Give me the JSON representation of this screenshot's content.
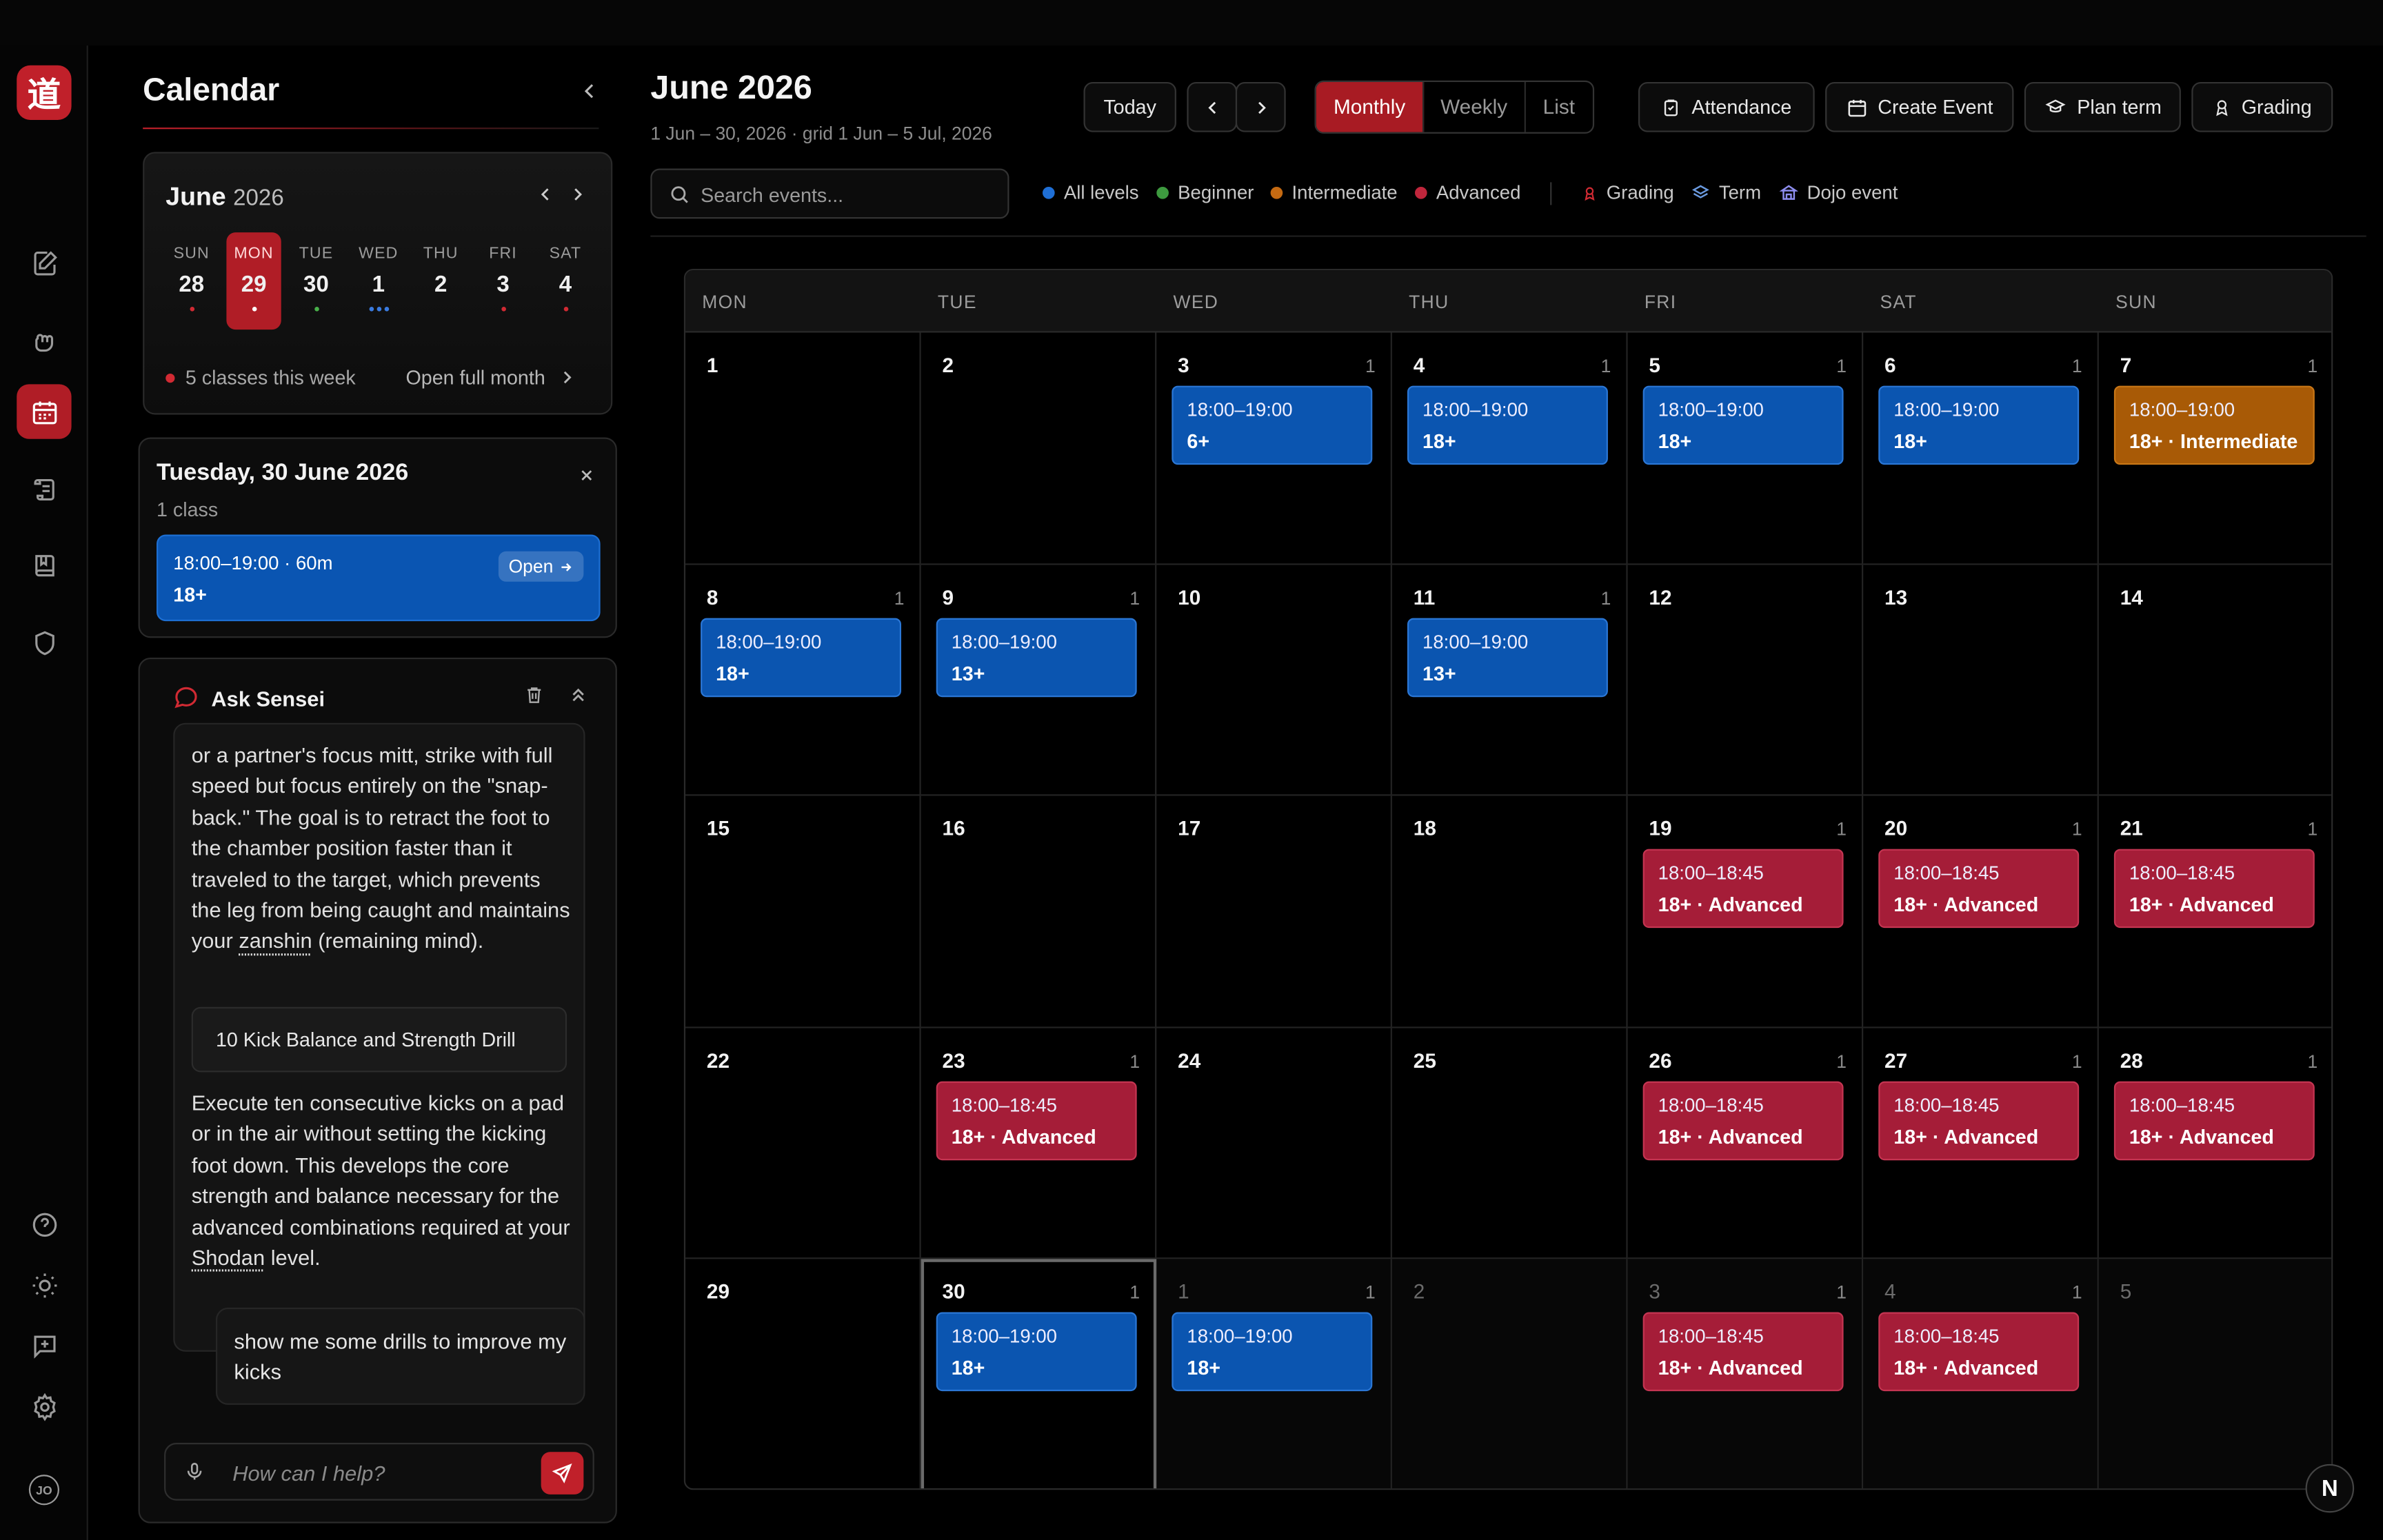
{
  "rail": {
    "logo": "道",
    "avatar": "JO",
    "icons": [
      "notes-icon",
      "fist-icon",
      "calendar-icon",
      "scroll-icon",
      "book-icon",
      "shield-icon",
      "help-icon",
      "theme-icon",
      "feedback-icon",
      "settings-icon"
    ]
  },
  "sidebar": {
    "title": "Calendar",
    "mini_calendar": {
      "month": "June",
      "year": "2026",
      "days": [
        {
          "dow": "SUN",
          "num": "28",
          "dots": [
            "#d12a33"
          ],
          "selected": false
        },
        {
          "dow": "MON",
          "num": "29",
          "dots": [
            "#ffffff"
          ],
          "selected": true
        },
        {
          "dow": "TUE",
          "num": "30",
          "dots": [
            "#48b04a"
          ],
          "selected": false
        },
        {
          "dow": "WED",
          "num": "1",
          "dots": [
            "#3a7be0",
            "#3a7be0",
            "#3a7be0"
          ],
          "selected": false
        },
        {
          "dow": "THU",
          "num": "2",
          "dots": [],
          "selected": false
        },
        {
          "dow": "FRI",
          "num": "3",
          "dots": [
            "#d12a33"
          ],
          "selected": false
        },
        {
          "dow": "SAT",
          "num": "4",
          "dots": [
            "#d12a33"
          ],
          "selected": false
        }
      ],
      "week_summary": "5 classes this week",
      "open_full_month": "Open full month"
    },
    "day_card": {
      "title": "Tuesday, 30 June 2026",
      "subtitle": "1 class",
      "event_time": "18:00–19:00 · 60m",
      "event_audience": "18+",
      "open_label": "Open"
    },
    "sensei": {
      "title": "Ask Sensei",
      "para1_pre": "or a partner's focus mitt, strike with full speed but focus entirely on the \"snap-back.\" The goal is to retract the foot to the chamber position faster than it traveled to the target, which prevents the leg from being caught and maintains your ",
      "para1_term": "zanshin",
      "para1_post": " (remaining mind).",
      "drill_title": "10 Kick Balance and Strength Drill",
      "para2_pre": "Execute ten consecutive kicks on a pad or in the air without setting the kicking foot down. This develops the core strength and balance necessary for the advanced combinations required at your ",
      "para2_term": "Shodan",
      "para2_post": " level.",
      "user_message": "show me some drills to improve my kicks",
      "input_placeholder": "How can I help?"
    }
  },
  "header": {
    "title": "June 2026",
    "subtitle": "1 Jun – 30, 2026 · grid 1 Jun – 5 Jul, 2026",
    "today": "Today",
    "views": [
      "Monthly",
      "Weekly",
      "List"
    ],
    "active_view": "Monthly",
    "actions": [
      "Attendance",
      "Create Event",
      "Plan term",
      "Grading"
    ],
    "search_placeholder": "Search events...",
    "legend_levels": [
      {
        "label": "All levels",
        "color": "#1f6fd6"
      },
      {
        "label": "Beginner",
        "color": "#3d9a3f"
      },
      {
        "label": "Intermediate",
        "color": "#c56a12"
      },
      {
        "label": "Advanced",
        "color": "#c0263c"
      }
    ],
    "legend_types": [
      "Grading",
      "Term",
      "Dojo event"
    ]
  },
  "calendar": {
    "dow": [
      "MON",
      "TUE",
      "WED",
      "THU",
      "FRI",
      "SAT",
      "SUN"
    ],
    "weeks": [
      [
        {
          "day": "1"
        },
        {
          "day": "2"
        },
        {
          "day": "3",
          "count": "1",
          "event": {
            "time": "18:00–19:00",
            "label": "6+",
            "color": "blue"
          }
        },
        {
          "day": "4",
          "count": "1",
          "event": {
            "time": "18:00–19:00",
            "label": "18+",
            "color": "blue"
          }
        },
        {
          "day": "5",
          "count": "1",
          "event": {
            "time": "18:00–19:00",
            "label": "18+",
            "color": "blue"
          }
        },
        {
          "day": "6",
          "count": "1",
          "event": {
            "time": "18:00–19:00",
            "label": "18+",
            "color": "blue"
          }
        },
        {
          "day": "7",
          "count": "1",
          "event": {
            "time": "18:00–19:00",
            "label": "18+ · Intermediate",
            "color": "orange"
          }
        }
      ],
      [
        {
          "day": "8",
          "count": "1",
          "event": {
            "time": "18:00–19:00",
            "label": "18+",
            "color": "blue"
          }
        },
        {
          "day": "9",
          "count": "1",
          "event": {
            "time": "18:00–19:00",
            "label": "13+",
            "color": "blue"
          }
        },
        {
          "day": "10"
        },
        {
          "day": "11",
          "count": "1",
          "event": {
            "time": "18:00–19:00",
            "label": "13+",
            "color": "blue"
          }
        },
        {
          "day": "12"
        },
        {
          "day": "13"
        },
        {
          "day": "14"
        }
      ],
      [
        {
          "day": "15"
        },
        {
          "day": "16"
        },
        {
          "day": "17"
        },
        {
          "day": "18"
        },
        {
          "day": "19",
          "count": "1",
          "event": {
            "time": "18:00–18:45",
            "label": "18+ · Advanced",
            "color": "red"
          }
        },
        {
          "day": "20",
          "count": "1",
          "event": {
            "time": "18:00–18:45",
            "label": "18+ · Advanced",
            "color": "red"
          }
        },
        {
          "day": "21",
          "count": "1",
          "event": {
            "time": "18:00–18:45",
            "label": "18+ · Advanced",
            "color": "red"
          }
        }
      ],
      [
        {
          "day": "22"
        },
        {
          "day": "23",
          "count": "1",
          "event": {
            "time": "18:00–18:45",
            "label": "18+ · Advanced",
            "color": "red"
          }
        },
        {
          "day": "24"
        },
        {
          "day": "25"
        },
        {
          "day": "26",
          "count": "1",
          "event": {
            "time": "18:00–18:45",
            "label": "18+ · Advanced",
            "color": "red"
          }
        },
        {
          "day": "27",
          "count": "1",
          "event": {
            "time": "18:00–18:45",
            "label": "18+ · Advanced",
            "color": "red"
          }
        },
        {
          "day": "28",
          "count": "1",
          "event": {
            "time": "18:00–18:45",
            "label": "18+ · Advanced",
            "color": "red"
          }
        }
      ],
      [
        {
          "day": "29"
        },
        {
          "day": "30",
          "count": "1",
          "today": true,
          "event": {
            "time": "18:00–19:00",
            "label": "18+",
            "color": "blue"
          }
        },
        {
          "day": "1",
          "count": "1",
          "dim": true,
          "event": {
            "time": "18:00–19:00",
            "label": "18+",
            "color": "blue"
          }
        },
        {
          "day": "2",
          "dim": true
        },
        {
          "day": "3",
          "count": "1",
          "dim": true,
          "event": {
            "time": "18:00–18:45",
            "label": "18+ · Advanced",
            "color": "red"
          }
        },
        {
          "day": "4",
          "count": "1",
          "dim": true,
          "event": {
            "time": "18:00–18:45",
            "label": "18+ · Advanced",
            "color": "red"
          }
        },
        {
          "day": "5",
          "dim": true
        }
      ]
    ]
  },
  "badge": "N"
}
